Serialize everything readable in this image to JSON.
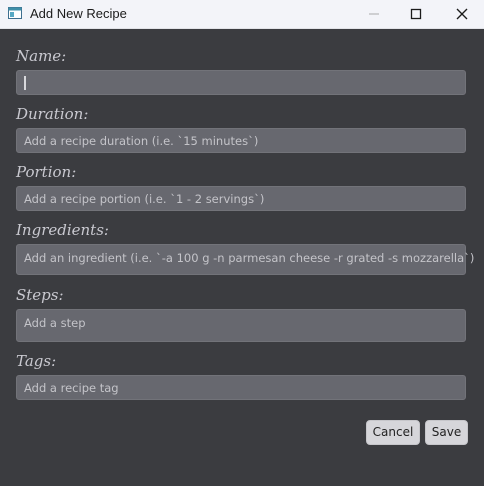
{
  "window": {
    "title": "Add New Recipe",
    "app_icon": "app-window-icon",
    "controls": [
      "minimize-icon",
      "maximize-icon",
      "close-icon"
    ]
  },
  "form": {
    "name": {
      "label": "Name:",
      "value": "",
      "placeholder": ""
    },
    "duration": {
      "label": "Duration:",
      "placeholder": "Add a recipe duration (i.e. `15 minutes`)"
    },
    "portion": {
      "label": "Portion:",
      "placeholder": "Add a recipe portion (i.e. `1 - 2 servings`)"
    },
    "ingredients": {
      "label": "Ingredients:",
      "placeholder": "Add an ingredient (i.e. `-a 100 g -n parmesan cheese -r grated -s mozzarella`)"
    },
    "steps": {
      "label": "Steps:",
      "placeholder": "Add a step"
    },
    "tags": {
      "label": "Tags:",
      "placeholder": "Add a recipe tag"
    }
  },
  "buttons": {
    "cancel": "Cancel",
    "save": "Save"
  },
  "colors": {
    "background": "#3b3c40",
    "field": "#67686f",
    "label": "#c9c9d0",
    "button": "#d6d6da",
    "titlebar": "#f3f4f9"
  }
}
